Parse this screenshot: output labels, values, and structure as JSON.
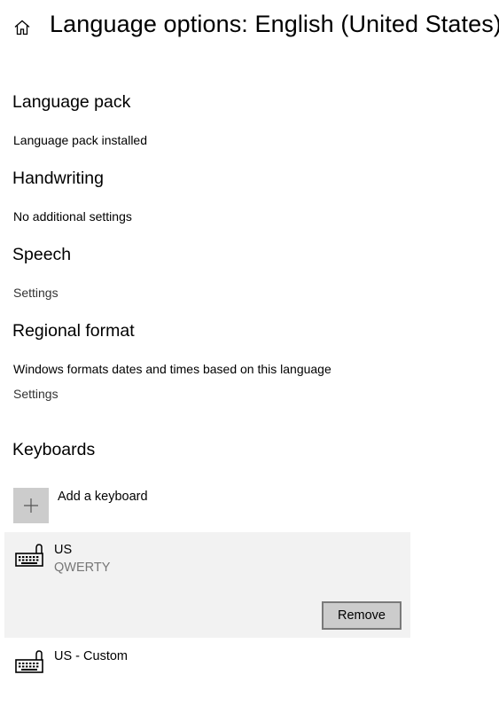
{
  "header": {
    "title": "Language options: English (United States)",
    "home_icon": "home-icon"
  },
  "sections": {
    "language_pack": {
      "heading": "Language pack",
      "status": "Language pack installed"
    },
    "handwriting": {
      "heading": "Handwriting",
      "status": "No additional settings"
    },
    "speech": {
      "heading": "Speech",
      "settings_link": "Settings"
    },
    "regional_format": {
      "heading": "Regional format",
      "description": "Windows formats dates and times based on this language",
      "settings_link": "Settings"
    },
    "keyboards": {
      "heading": "Keyboards",
      "add_label": "Add a keyboard",
      "add_icon": "plus-icon",
      "items": [
        {
          "name": "US",
          "layout": "QWERTY",
          "icon": "keyboard-icon",
          "selected": true,
          "remove_label": "Remove"
        },
        {
          "name": "US - Custom",
          "layout": "",
          "icon": "keyboard-icon",
          "selected": false
        }
      ]
    }
  },
  "colors": {
    "background": "#ffffff",
    "selected_item_bg": "#f2f2f2",
    "button_bg": "#cccccc",
    "button_border": "#7a7a7a",
    "secondary_text": "#767676"
  }
}
